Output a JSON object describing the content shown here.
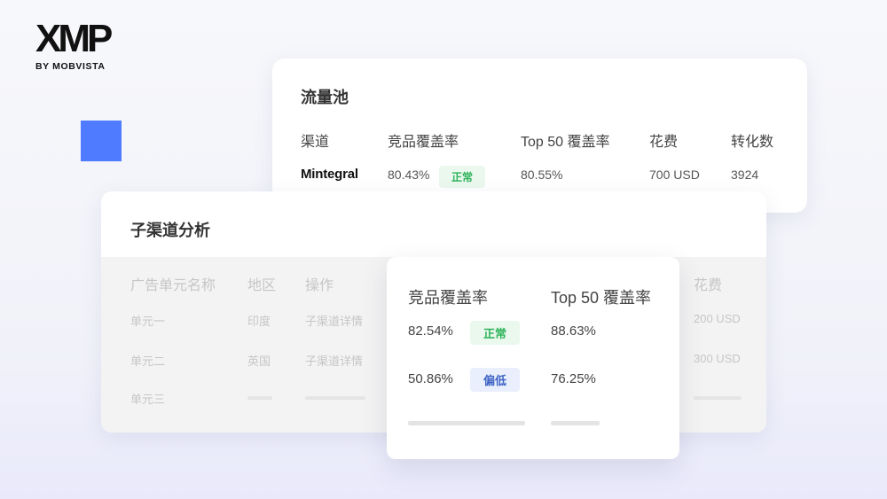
{
  "brand": {
    "logo_text": "XMP",
    "subtitle": "BY MOBVISTA"
  },
  "pool": {
    "title": "流量池",
    "headers": [
      "渠道",
      "竞品覆盖率",
      "Top 50 覆盖率",
      "花费",
      "转化数"
    ],
    "row": {
      "channel": "Mintegral",
      "coverage": "80.43%",
      "status": "正常",
      "top50": "80.55%",
      "spend": "700 USD",
      "conversions": "3924"
    }
  },
  "sub": {
    "title": "子渠道分析",
    "headers": [
      "广告单元名称",
      "地区",
      "操作",
      "花费"
    ],
    "rows": [
      {
        "name": "单元一",
        "region": "印度",
        "action": "子渠道详情",
        "spend": "200 USD"
      },
      {
        "name": "单元二",
        "region": "英国",
        "action": "子渠道详情",
        "spend": "300 USD"
      },
      {
        "name": "单元三"
      }
    ]
  },
  "popup": {
    "headers": [
      "竞品覆盖率",
      "Top 50 覆盖率"
    ],
    "rows": [
      {
        "coverage": "82.54%",
        "status": "正常",
        "status_color": "#2fb35a",
        "top50": "88.63%"
      },
      {
        "coverage": "50.86%",
        "status": "偏低",
        "status_color": "#3e63c4",
        "top50": "76.25%"
      }
    ]
  },
  "colors": {
    "accent": "#4e7bff",
    "ok": "#2fb35a",
    "low": "#3e63c4"
  }
}
